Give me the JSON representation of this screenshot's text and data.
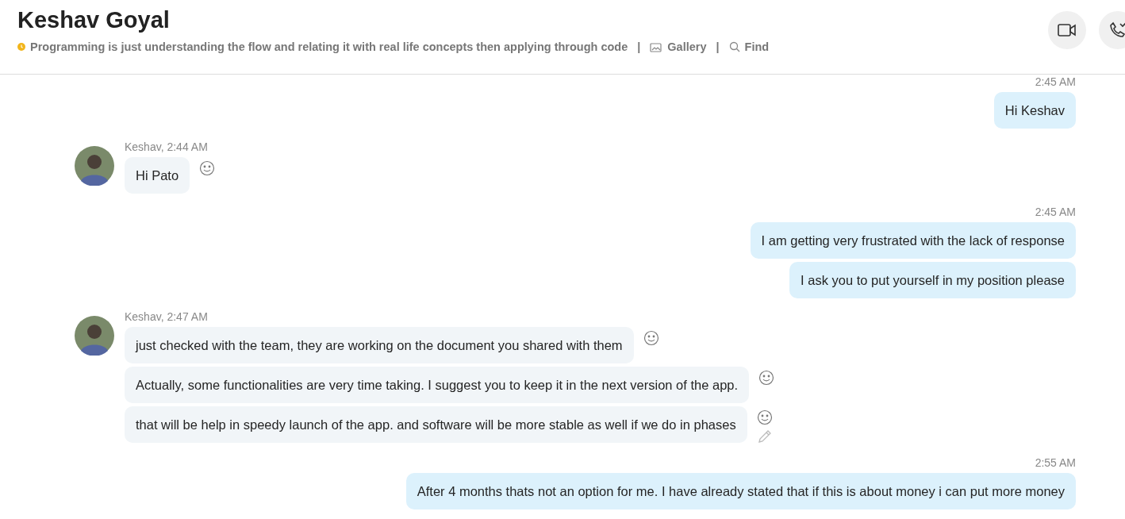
{
  "header": {
    "title": "Keshav Goyal",
    "mood": "Programming is just understanding the flow and relating it with real life concepts then applying through code",
    "links": [
      {
        "separator": "|",
        "label": "Gallery",
        "kind": "gallery"
      },
      {
        "separator": "|",
        "label": "Find",
        "kind": "find"
      }
    ],
    "actions": [
      {
        "kind": "video"
      },
      {
        "kind": "call"
      }
    ]
  },
  "messages": [
    {
      "kind": "outgoing",
      "meta": "2:45 AM",
      "bubbles": [
        {
          "text": "Hi Keshav"
        }
      ]
    },
    {
      "kind": "incoming",
      "meta": "Keshav, 2:44 AM",
      "bubbles": [
        {
          "text": "Hi Pato",
          "edit": false
        }
      ]
    },
    {
      "kind": "outgoing",
      "meta": "2:45 AM",
      "bubbles": [
        {
          "text": "I am getting very frustrated with the lack of response"
        },
        {
          "text": "I ask you to put yourself in my position please"
        }
      ]
    },
    {
      "kind": "incoming",
      "meta": "Keshav, 2:47 AM",
      "bubbles": [
        {
          "text": "just checked with the team, they are working on the document you shared with them",
          "edit": false
        },
        {
          "text": "Actually, some functionalities are very time taking. I suggest you to keep it in the next version of the app.",
          "edit": false
        },
        {
          "text": "that will be help in speedy launch of the app. and software will be more stable as well if we do in phases",
          "edit": true
        }
      ]
    },
    {
      "kind": "outgoing",
      "meta": "2:55 AM",
      "bubbles": [
        {
          "text": "After 4 months thats not an option for me. I have already stated that if this is about money i can put more money"
        }
      ]
    }
  ]
}
